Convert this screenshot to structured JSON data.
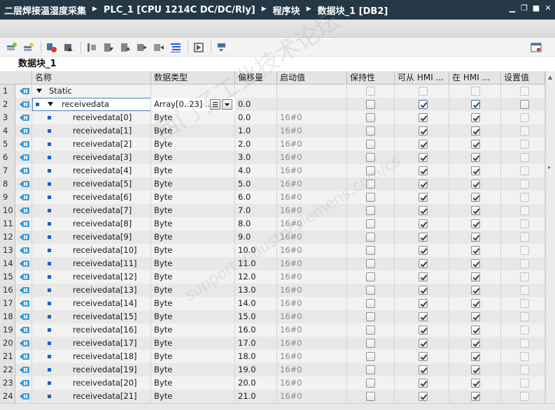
{
  "titlebar": {
    "crumbs": [
      "二层焊接温湿度采集",
      "PLC_1 [CPU 1214C DC/DC/Rly]",
      "程序块",
      "数据块_1 [DB2]"
    ],
    "sep_glyph": "▶",
    "controls": {
      "minimize": "▁",
      "restore": "❐",
      "maximize": "■",
      "close": "✕"
    }
  },
  "block": {
    "name": "数据块_1"
  },
  "columns": {
    "name": "名称",
    "type": "数据类型",
    "offset": "偏移量",
    "start": "启动值",
    "retain": "保持性",
    "hmi_access": "可从 HMI ...",
    "hmi_visible": "在 HMI ...",
    "setpoint": "设置值"
  },
  "rows": [
    {
      "num": "1",
      "name": "Static",
      "type": "",
      "offset": "",
      "start": ""
    },
    {
      "num": "2",
      "name": "receivedata",
      "type": "Array[0..23] ...",
      "offset": "0.0",
      "start": ""
    },
    {
      "num": "3",
      "name": "receivedata[0]",
      "type": "Byte",
      "offset": "0.0",
      "start": "16#0"
    },
    {
      "num": "4",
      "name": "receivedata[1]",
      "type": "Byte",
      "offset": "1.0",
      "start": "16#0"
    },
    {
      "num": "5",
      "name": "receivedata[2]",
      "type": "Byte",
      "offset": "2.0",
      "start": "16#0"
    },
    {
      "num": "6",
      "name": "receivedata[3]",
      "type": "Byte",
      "offset": "3.0",
      "start": "16#0"
    },
    {
      "num": "7",
      "name": "receivedata[4]",
      "type": "Byte",
      "offset": "4.0",
      "start": "16#0"
    },
    {
      "num": "8",
      "name": "receivedata[5]",
      "type": "Byte",
      "offset": "5.0",
      "start": "16#0"
    },
    {
      "num": "9",
      "name": "receivedata[6]",
      "type": "Byte",
      "offset": "6.0",
      "start": "16#0"
    },
    {
      "num": "10",
      "name": "receivedata[7]",
      "type": "Byte",
      "offset": "7.0",
      "start": "16#0"
    },
    {
      "num": "11",
      "name": "receivedata[8]",
      "type": "Byte",
      "offset": "8.0",
      "start": "16#0"
    },
    {
      "num": "12",
      "name": "receivedata[9]",
      "type": "Byte",
      "offset": "9.0",
      "start": "16#0"
    },
    {
      "num": "13",
      "name": "receivedata[10]",
      "type": "Byte",
      "offset": "10.0",
      "start": "16#0"
    },
    {
      "num": "14",
      "name": "receivedata[11]",
      "type": "Byte",
      "offset": "11.0",
      "start": "16#0"
    },
    {
      "num": "15",
      "name": "receivedata[12]",
      "type": "Byte",
      "offset": "12.0",
      "start": "16#0"
    },
    {
      "num": "16",
      "name": "receivedata[13]",
      "type": "Byte",
      "offset": "13.0",
      "start": "16#0"
    },
    {
      "num": "17",
      "name": "receivedata[14]",
      "type": "Byte",
      "offset": "14.0",
      "start": "16#0"
    },
    {
      "num": "18",
      "name": "receivedata[15]",
      "type": "Byte",
      "offset": "15.0",
      "start": "16#0"
    },
    {
      "num": "19",
      "name": "receivedata[16]",
      "type": "Byte",
      "offset": "16.0",
      "start": "16#0"
    },
    {
      "num": "20",
      "name": "receivedata[17]",
      "type": "Byte",
      "offset": "17.0",
      "start": "16#0"
    },
    {
      "num": "21",
      "name": "receivedata[18]",
      "type": "Byte",
      "offset": "18.0",
      "start": "16#0"
    },
    {
      "num": "22",
      "name": "receivedata[19]",
      "type": "Byte",
      "offset": "19.0",
      "start": "16#0"
    },
    {
      "num": "23",
      "name": "receivedata[20]",
      "type": "Byte",
      "offset": "20.0",
      "start": "16#0"
    },
    {
      "num": "24",
      "name": "receivedata[21]",
      "type": "Byte",
      "offset": "21.0",
      "start": "16#0"
    }
  ],
  "watermark": {
    "line1": "西门子工业技术论坛",
    "line2": "support.industry.siemens.com/cs"
  },
  "colors": {
    "titlebar": "#243846",
    "accent": "#1a5fd0",
    "selection_border": "#4e7fbf"
  }
}
